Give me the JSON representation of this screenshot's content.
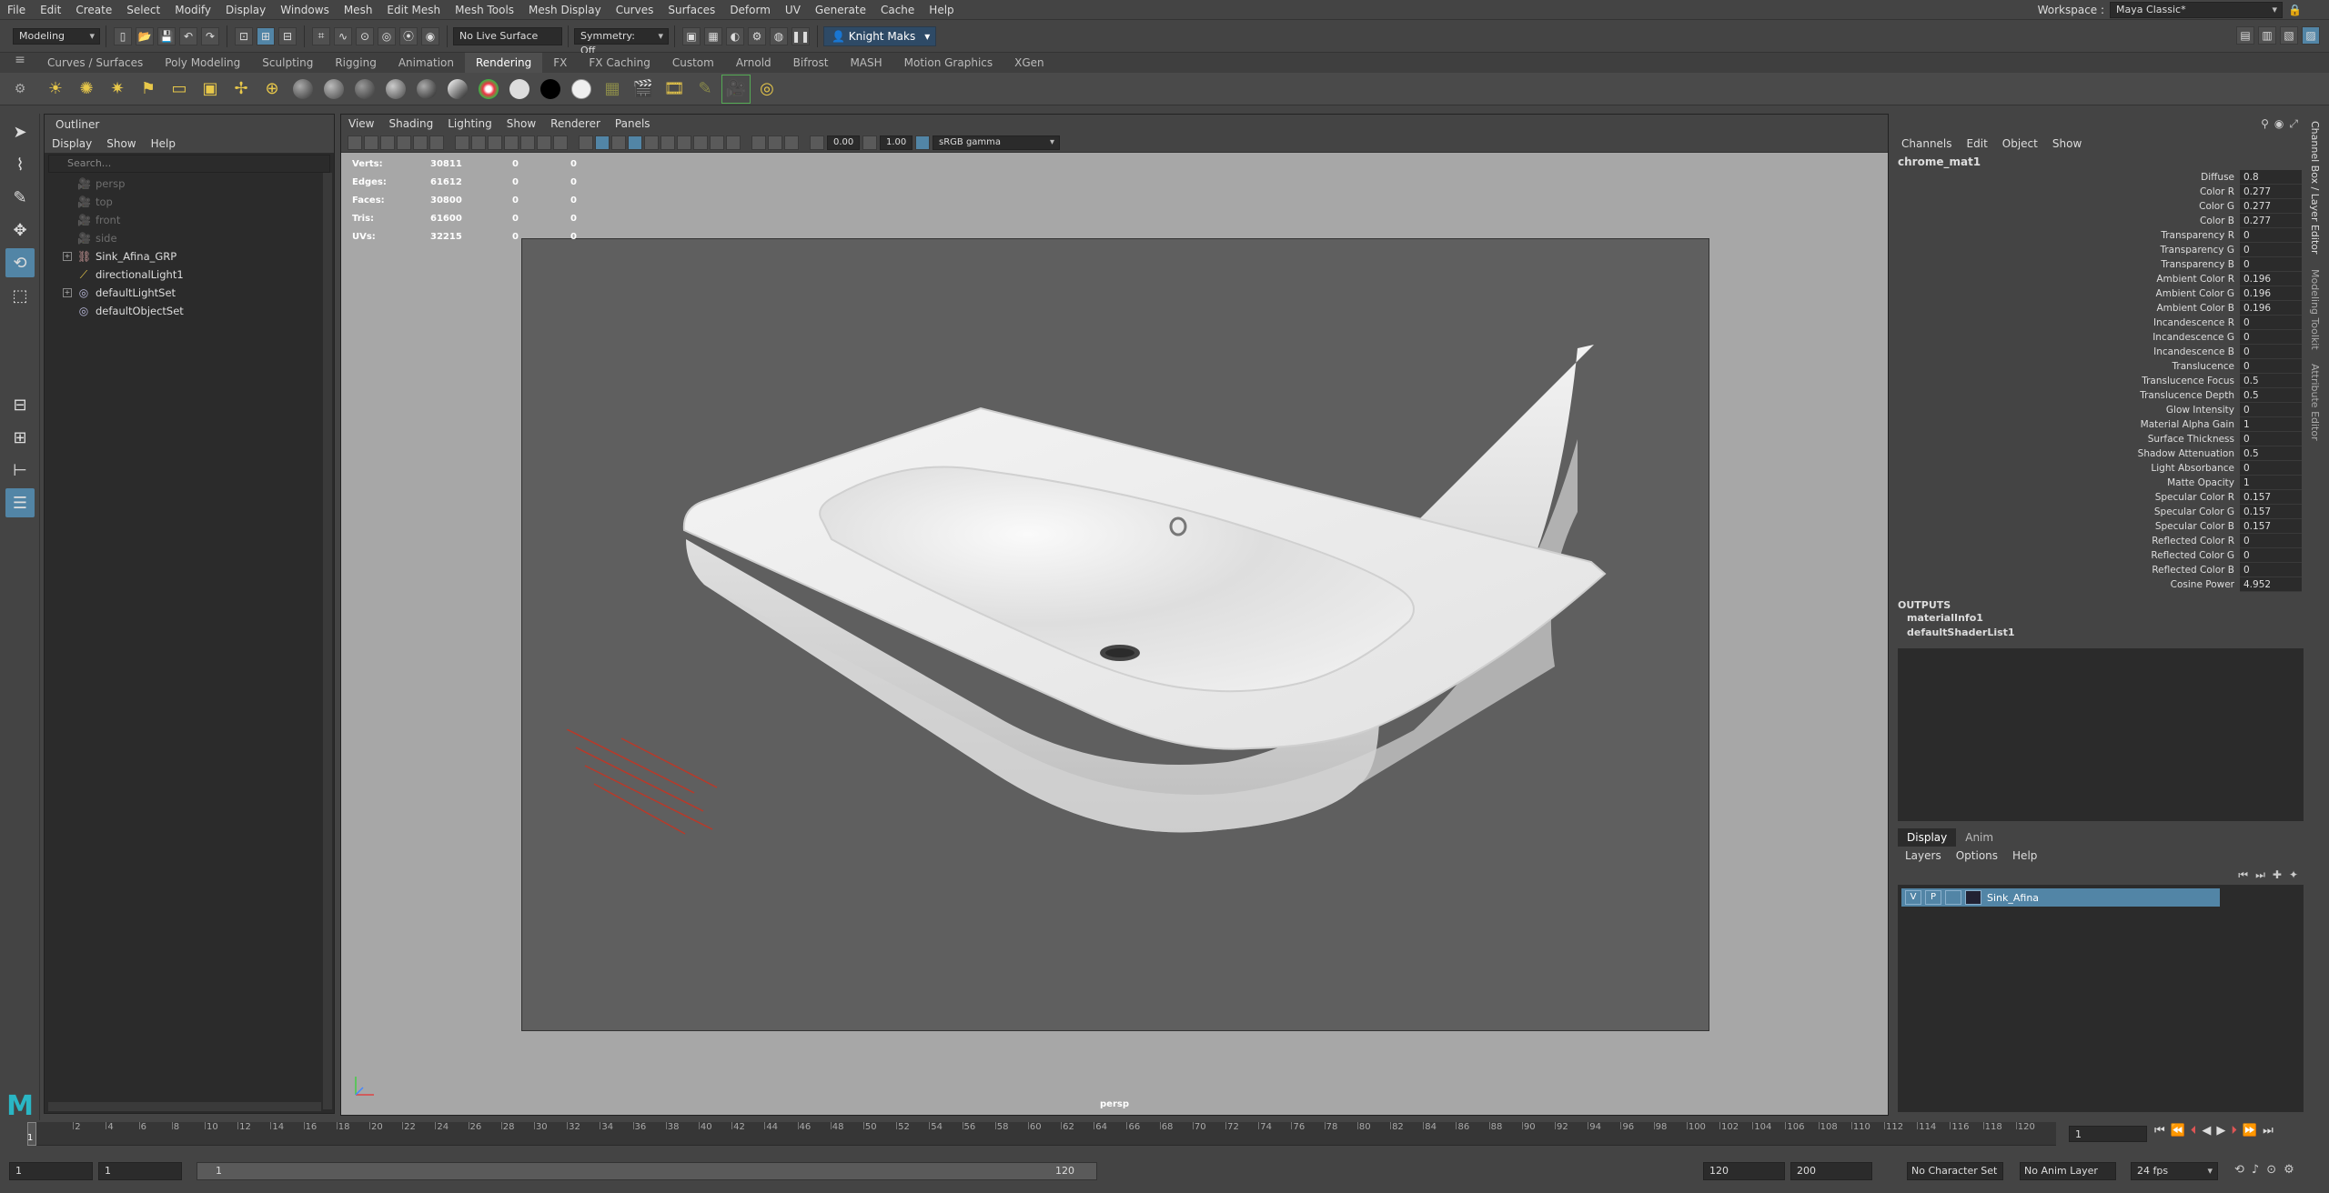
{
  "menubar": {
    "items": [
      "File",
      "Edit",
      "Create",
      "Select",
      "Modify",
      "Display",
      "Windows",
      "Mesh",
      "Edit Mesh",
      "Mesh Tools",
      "Mesh Display",
      "Curves",
      "Surfaces",
      "Deform",
      "UV",
      "Generate",
      "Cache",
      "Help"
    ],
    "workspace_label": "Workspace :",
    "workspace_value": "Maya Classic*"
  },
  "statusline": {
    "mode": "Modeling",
    "live_surface": "No Live Surface",
    "symmetry": "Symmetry: Off",
    "user": "Knight Maks"
  },
  "shelf": {
    "tabs": [
      "Curves / Surfaces",
      "Poly Modeling",
      "Sculpting",
      "Rigging",
      "Animation",
      "Rendering",
      "FX",
      "FX Caching",
      "Custom",
      "Arnold",
      "Bifrost",
      "MASH",
      "Motion Graphics",
      "XGen"
    ],
    "active_tab": "Rendering"
  },
  "outliner": {
    "title": "Outliner",
    "menus": [
      "Display",
      "Show",
      "Help"
    ],
    "search_placeholder": "Search...",
    "items": [
      {
        "label": "persp",
        "dim": true,
        "icon": "camera-icon"
      },
      {
        "label": "top",
        "dim": true,
        "icon": "camera-icon"
      },
      {
        "label": "front",
        "dim": true,
        "icon": "camera-icon"
      },
      {
        "label": "side",
        "dim": true,
        "icon": "camera-icon"
      },
      {
        "label": "Sink_Afina_GRP",
        "dim": false,
        "icon": "group-icon",
        "expandable": true
      },
      {
        "label": "directionalLight1",
        "dim": false,
        "icon": "directional-light-icon"
      },
      {
        "label": "defaultLightSet",
        "dim": false,
        "icon": "set-icon",
        "expandable": true
      },
      {
        "label": "defaultObjectSet",
        "dim": false,
        "icon": "set-icon"
      }
    ]
  },
  "viewport": {
    "menus": [
      "View",
      "Shading",
      "Lighting",
      "Show",
      "Renderer",
      "Panels"
    ],
    "exposure": "0.00",
    "gamma": "1.00",
    "color_space": "sRGB gamma",
    "camera": "persp",
    "hud": [
      {
        "label": "Verts:",
        "v1": "30811",
        "v2": "0",
        "v3": "0"
      },
      {
        "label": "Edges:",
        "v1": "61612",
        "v2": "0",
        "v3": "0"
      },
      {
        "label": "Faces:",
        "v1": "30800",
        "v2": "0",
        "v3": "0"
      },
      {
        "label": "Tris:",
        "v1": "61600",
        "v2": "0",
        "v3": "0"
      },
      {
        "label": "UVs:",
        "v1": "32215",
        "v2": "0",
        "v3": "0"
      }
    ]
  },
  "channelbox": {
    "menus": [
      "Channels",
      "Edit",
      "Object",
      "Show"
    ],
    "node": "chrome_mat1",
    "attrs": [
      {
        "n": "Diffuse",
        "v": "0.8"
      },
      {
        "n": "Color R",
        "v": "0.277"
      },
      {
        "n": "Color G",
        "v": "0.277"
      },
      {
        "n": "Color B",
        "v": "0.277"
      },
      {
        "n": "Transparency R",
        "v": "0"
      },
      {
        "n": "Transparency G",
        "v": "0"
      },
      {
        "n": "Transparency B",
        "v": "0"
      },
      {
        "n": "Ambient Color R",
        "v": "0.196"
      },
      {
        "n": "Ambient Color G",
        "v": "0.196"
      },
      {
        "n": "Ambient Color B",
        "v": "0.196"
      },
      {
        "n": "Incandescence R",
        "v": "0"
      },
      {
        "n": "Incandescence G",
        "v": "0"
      },
      {
        "n": "Incandescence B",
        "v": "0"
      },
      {
        "n": "Translucence",
        "v": "0"
      },
      {
        "n": "Translucence Focus",
        "v": "0.5"
      },
      {
        "n": "Translucence Depth",
        "v": "0.5"
      },
      {
        "n": "Glow Intensity",
        "v": "0"
      },
      {
        "n": "Material Alpha Gain",
        "v": "1"
      },
      {
        "n": "Surface Thickness",
        "v": "0"
      },
      {
        "n": "Shadow Attenuation",
        "v": "0.5"
      },
      {
        "n": "Light Absorbance",
        "v": "0"
      },
      {
        "n": "Matte Opacity",
        "v": "1"
      },
      {
        "n": "Specular Color R",
        "v": "0.157"
      },
      {
        "n": "Specular Color G",
        "v": "0.157"
      },
      {
        "n": "Specular Color B",
        "v": "0.157"
      },
      {
        "n": "Reflected Color R",
        "v": "0"
      },
      {
        "n": "Reflected Color G",
        "v": "0"
      },
      {
        "n": "Reflected Color B",
        "v": "0"
      },
      {
        "n": "Cosine Power",
        "v": "4.952"
      }
    ],
    "outputs_label": "OUTPUTS",
    "outputs": [
      "materialInfo1",
      "defaultShaderList1"
    ]
  },
  "layers": {
    "tabs": [
      "Display",
      "Anim"
    ],
    "menus": [
      "Layers",
      "Options",
      "Help"
    ],
    "layer_name": "Sink_Afina",
    "v": "V",
    "p": "P"
  },
  "side_tabs": [
    "Channel Box / Layer Editor",
    "Modeling Toolkit",
    "Attribute Editor"
  ],
  "timeline": {
    "ticks": [
      "2",
      "4",
      "6",
      "8",
      "10",
      "12",
      "14",
      "16",
      "18",
      "20",
      "22",
      "24",
      "26",
      "28",
      "30",
      "32",
      "34",
      "36",
      "38",
      "40",
      "42",
      "44",
      "46",
      "48",
      "50",
      "52",
      "54",
      "56",
      "58",
      "60",
      "62",
      "64",
      "66",
      "68",
      "70",
      "72",
      "74",
      "76",
      "78",
      "80",
      "82",
      "84",
      "86",
      "88",
      "90",
      "92",
      "94",
      "96",
      "98",
      "100",
      "102",
      "104",
      "106",
      "108",
      "110",
      "112",
      "114",
      "116",
      "118",
      "120"
    ],
    "current_marker": "1",
    "current_frame": "1"
  },
  "range": {
    "start": "1",
    "anim_start": "1",
    "bar_start": "1",
    "bar_end": "120",
    "anim_end": "120",
    "end": "200",
    "char_set": "No Character Set",
    "anim_layer": "No Anim Layer",
    "fps": "24 fps"
  }
}
